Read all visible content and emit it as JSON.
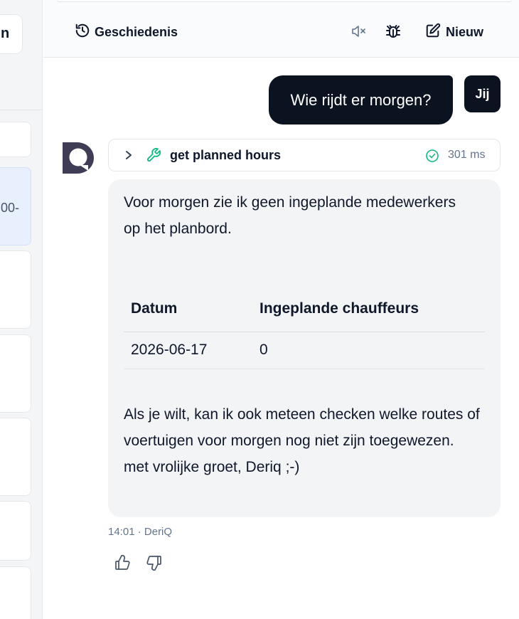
{
  "sidebar": {
    "button_label": "n",
    "selected_item_text": "00-"
  },
  "header": {
    "history_label": "Geschiedenis",
    "new_label": "Nieuw",
    "icons": [
      "history-icon",
      "speaker-muted-icon",
      "bug-icon",
      "edit-icon"
    ]
  },
  "user_message": {
    "text": "Wie rijdt er morgen?",
    "avatar_label": "Jij"
  },
  "tool_call": {
    "name": "get planned hours",
    "status": "success",
    "duration": "301 ms"
  },
  "bot_message": {
    "intro": "Voor morgen zie ik geen ingeplande medewerkers op het planbord.",
    "table": {
      "headers": [
        "Datum",
        "Ingeplande chauffeurs"
      ],
      "rows": [
        [
          "2026-06-17",
          "0"
        ]
      ]
    },
    "outro": "Als je wilt, kan ik ook meteen checken welke routes of voertuigen voor morgen nog niet zijn toegewezen.",
    "signoff": "met vrolijke groet, Deriq ;-)",
    "time": "14:01",
    "author": "DeriQ"
  },
  "colors": {
    "user_bubble": "#0b1220",
    "bot_bubble": "#f3f4f6",
    "brand": "#3f3d56",
    "tool_accent": "#10b981"
  }
}
